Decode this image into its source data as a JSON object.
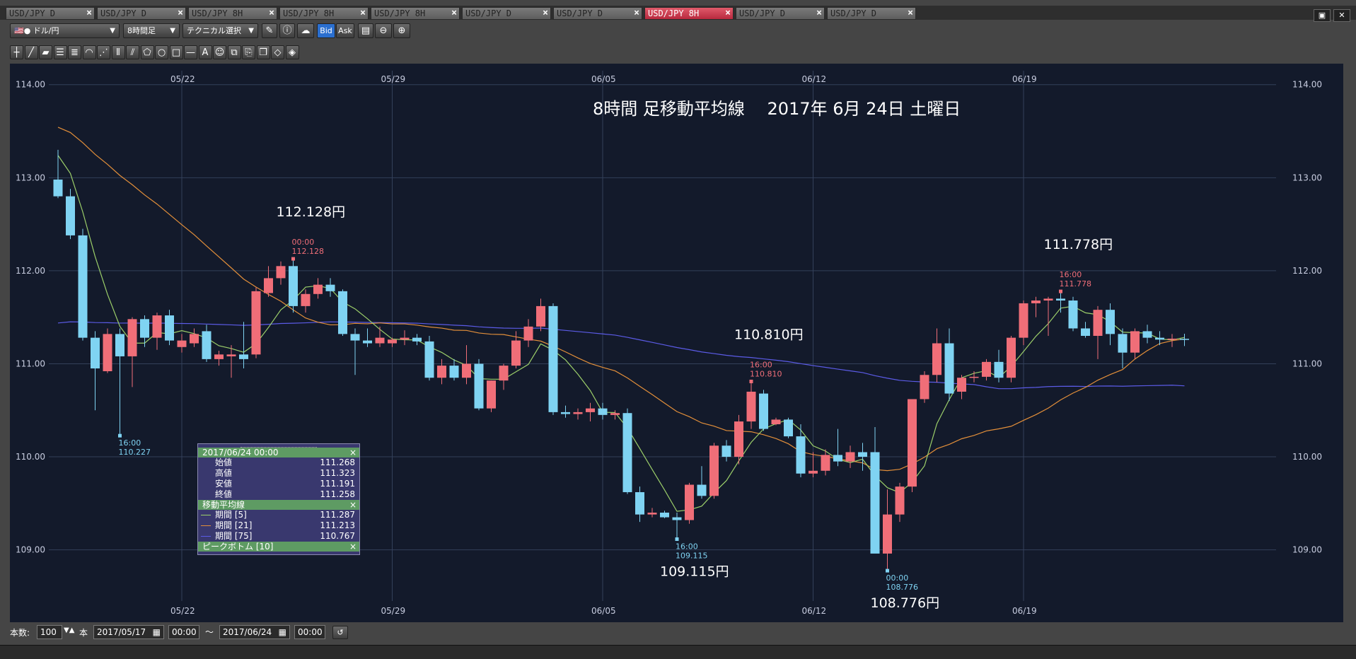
{
  "tabs": [
    {
      "label": "USD/JPY D",
      "active": false
    },
    {
      "label": "USD/JPY D",
      "active": false
    },
    {
      "label": "USD/JPY 8H",
      "active": false
    },
    {
      "label": "USD/JPY 8H",
      "active": false
    },
    {
      "label": "USD/JPY 8H",
      "active": false
    },
    {
      "label": "USD/JPY D",
      "active": false
    },
    {
      "label": "USD/JPY D",
      "active": false
    },
    {
      "label": "USD/JPY 8H",
      "active": true
    },
    {
      "label": "USD/JPY D",
      "active": false
    },
    {
      "label": "USD/JPY D",
      "active": false
    }
  ],
  "toolbar": {
    "symbol": "ドル/円",
    "timeframe": "8時間足",
    "technical": "テクニカル選択",
    "bid": "Bid",
    "ask": "Ask"
  },
  "bottom": {
    "count_label": "本数:",
    "count_value": "100",
    "count_unit": "本",
    "start_date": "2017/05/17",
    "start_time": "00:00",
    "tilde": "〜",
    "end_date": "2017/06/24",
    "end_time": "00:00"
  },
  "info_panel": {
    "date": "2017/06/24 00:00",
    "ohlc": [
      {
        "label": "始値",
        "value": "111.268"
      },
      {
        "label": "高値",
        "value": "111.323"
      },
      {
        "label": "安値",
        "value": "111.191"
      },
      {
        "label": "終値",
        "value": "111.258"
      }
    ],
    "ma_title": "移動平均線",
    "ma": [
      {
        "label": "期間 [5]",
        "value": "111.287",
        "color": "#9ccf6a"
      },
      {
        "label": "期間 [21]",
        "value": "111.213",
        "color": "#e38f3a"
      },
      {
        "label": "期間 [75]",
        "value": "110.767",
        "color": "#5b5be6"
      }
    ],
    "peak_title": "ピークボトム [10]",
    "close": "×"
  },
  "chart_data": {
    "type": "candlestick",
    "title": "8時間 足移動平均線　 2017年 6月 24日 土曜日",
    "ylim": [
      108.45,
      114.15
    ],
    "yticks": [
      "114.00",
      "113.00",
      "112.00",
      "111.00",
      "110.00",
      "109.00"
    ],
    "xticks": [
      {
        "label": "05/22",
        "index": 10
      },
      {
        "label": "05/29",
        "index": 27
      },
      {
        "label": "06/05",
        "index": 44
      },
      {
        "label": "06/12",
        "index": 61
      },
      {
        "label": "06/19",
        "index": 78
      }
    ],
    "colors": {
      "up": "#f06e78",
      "down": "#7fd3f2",
      "ma5": "#9ccf6a",
      "ma21": "#e38f3a",
      "ma75": "#5b5be6",
      "grid": "#33405a",
      "bg": "#131a2b"
    },
    "candles": [
      [
        112.98,
        113.3,
        112.78,
        112.8
      ],
      [
        112.8,
        112.88,
        112.34,
        112.38
      ],
      [
        112.38,
        112.45,
        111.25,
        111.28
      ],
      [
        111.28,
        111.35,
        110.5,
        110.95
      ],
      [
        110.92,
        111.38,
        110.9,
        111.32
      ],
      [
        111.32,
        111.38,
        110.23,
        111.08
      ],
      [
        111.08,
        111.5,
        110.75,
        111.48
      ],
      [
        111.48,
        111.52,
        111.18,
        111.28
      ],
      [
        111.28,
        111.55,
        111.15,
        111.52
      ],
      [
        111.52,
        111.58,
        111.2,
        111.25
      ],
      [
        111.18,
        111.32,
        111.12,
        111.25
      ],
      [
        111.22,
        111.38,
        111.18,
        111.32
      ],
      [
        111.35,
        111.42,
        111.02,
        111.05
      ],
      [
        111.05,
        111.14,
        110.98,
        111.1
      ],
      [
        111.08,
        111.2,
        110.85,
        111.1
      ],
      [
        111.1,
        111.45,
        110.95,
        111.05
      ],
      [
        111.1,
        111.82,
        111.06,
        111.78
      ],
      [
        111.76,
        112.05,
        111.72,
        111.92
      ],
      [
        111.92,
        112.1,
        111.85,
        112.05
      ],
      [
        112.05,
        112.128,
        111.55,
        111.62
      ],
      [
        111.62,
        111.8,
        111.55,
        111.75
      ],
      [
        111.75,
        111.92,
        111.7,
        111.85
      ],
      [
        111.85,
        111.92,
        111.72,
        111.78
      ],
      [
        111.78,
        111.8,
        111.3,
        111.32
      ],
      [
        111.32,
        111.38,
        110.88,
        111.25
      ],
      [
        111.25,
        111.38,
        111.18,
        111.22
      ],
      [
        111.22,
        111.4,
        111.18,
        111.28
      ],
      [
        111.22,
        111.28,
        111.18,
        111.26
      ],
      [
        111.26,
        111.36,
        111.2,
        111.28
      ],
      [
        111.28,
        111.32,
        111.2,
        111.24
      ],
      [
        111.24,
        111.3,
        110.82,
        110.85
      ],
      [
        110.85,
        111.05,
        110.78,
        110.98
      ],
      [
        110.98,
        111.05,
        110.82,
        110.85
      ],
      [
        110.85,
        111.2,
        110.78,
        111.0
      ],
      [
        111.0,
        111.05,
        110.5,
        110.52
      ],
      [
        110.52,
        110.82,
        110.48,
        110.82
      ],
      [
        110.82,
        111.0,
        110.72,
        110.98
      ],
      [
        110.98,
        111.35,
        110.95,
        111.25
      ],
      [
        111.25,
        111.48,
        111.18,
        111.4
      ],
      [
        111.4,
        111.7,
        111.35,
        111.62
      ],
      [
        111.62,
        111.65,
        110.45,
        110.48
      ],
      [
        110.48,
        110.55,
        110.42,
        110.46
      ],
      [
        110.46,
        110.52,
        110.4,
        110.48
      ],
      [
        110.48,
        110.58,
        110.38,
        110.52
      ],
      [
        110.52,
        110.58,
        110.4,
        110.45
      ],
      [
        110.45,
        110.5,
        110.4,
        110.47
      ],
      [
        110.47,
        110.52,
        109.6,
        109.62
      ],
      [
        109.62,
        109.68,
        109.3,
        109.38
      ],
      [
        109.38,
        109.45,
        109.35,
        109.4
      ],
      [
        109.4,
        109.42,
        109.34,
        109.35
      ],
      [
        109.35,
        109.4,
        109.115,
        109.32
      ],
      [
        109.32,
        109.72,
        109.28,
        109.7
      ],
      [
        109.7,
        109.9,
        109.55,
        109.58
      ],
      [
        109.58,
        110.15,
        109.55,
        110.12
      ],
      [
        110.12,
        110.18,
        109.95,
        110.0
      ],
      [
        110.0,
        110.45,
        109.92,
        110.38
      ],
      [
        110.38,
        110.81,
        110.3,
        110.7
      ],
      [
        110.68,
        110.72,
        110.28,
        110.3
      ],
      [
        110.35,
        110.42,
        110.34,
        110.4
      ],
      [
        110.4,
        110.42,
        110.2,
        110.22
      ],
      [
        110.22,
        110.35,
        109.78,
        109.82
      ],
      [
        109.82,
        110.05,
        109.78,
        109.85
      ],
      [
        109.85,
        110.08,
        109.8,
        110.02
      ],
      [
        110.02,
        110.3,
        109.9,
        109.95
      ],
      [
        109.95,
        110.12,
        109.88,
        110.05
      ],
      [
        110.05,
        110.15,
        109.85,
        110.0
      ],
      [
        110.05,
        110.32,
        109.9,
        108.96
      ],
      [
        108.96,
        109.65,
        108.776,
        109.38
      ],
      [
        109.38,
        109.72,
        109.3,
        109.68
      ],
      [
        109.68,
        110.62,
        109.62,
        110.62
      ],
      [
        110.62,
        110.92,
        110.58,
        110.88
      ],
      [
        110.88,
        111.38,
        110.8,
        111.22
      ],
      [
        111.22,
        111.38,
        110.6,
        110.68
      ],
      [
        110.7,
        110.88,
        110.62,
        110.85
      ],
      [
        110.85,
        110.92,
        110.8,
        110.86
      ],
      [
        110.86,
        111.05,
        110.82,
        111.02
      ],
      [
        111.02,
        111.15,
        110.8,
        110.85
      ],
      [
        110.85,
        111.3,
        110.8,
        111.28
      ],
      [
        111.28,
        111.68,
        111.2,
        111.65
      ],
      [
        111.65,
        111.72,
        111.5,
        111.68
      ],
      [
        111.68,
        111.72,
        111.3,
        111.7
      ],
      [
        111.7,
        111.778,
        111.55,
        111.68
      ],
      [
        111.68,
        111.72,
        111.35,
        111.38
      ],
      [
        111.38,
        111.45,
        111.28,
        111.3
      ],
      [
        111.3,
        111.62,
        111.05,
        111.58
      ],
      [
        111.58,
        111.65,
        111.2,
        111.32
      ],
      [
        111.32,
        111.38,
        110.95,
        111.12
      ],
      [
        111.12,
        111.38,
        111.05,
        111.35
      ],
      [
        111.35,
        111.42,
        111.22,
        111.28
      ],
      [
        111.28,
        111.35,
        111.2,
        111.26
      ],
      [
        111.26,
        111.32,
        111.18,
        111.27
      ],
      [
        111.268,
        111.323,
        111.191,
        111.258
      ]
    ],
    "ma5_start": 113.35,
    "ma21_start": 113.58,
    "ma75_start": 111.42,
    "annotations": [
      {
        "index": 19,
        "price": 112.128,
        "time": "00:00",
        "value": "112.128",
        "big": "112.128円",
        "type": "high"
      },
      {
        "index": 5,
        "price": 110.227,
        "time": "16:00",
        "value": "110.227",
        "type": "low"
      },
      {
        "index": 50,
        "price": 109.115,
        "time": "16:00",
        "value": "109.115",
        "big": "109.115円",
        "type": "low"
      },
      {
        "index": 56,
        "price": 110.81,
        "time": "16:00",
        "value": "110.810",
        "big": "110.810円",
        "type": "high"
      },
      {
        "index": 67,
        "price": 108.776,
        "time": "00:00",
        "value": "108.776",
        "big": "108.776円",
        "type": "low"
      },
      {
        "index": 81,
        "price": 111.778,
        "time": "16:00",
        "value": "111.778",
        "big": "111.778円",
        "type": "high"
      }
    ]
  }
}
